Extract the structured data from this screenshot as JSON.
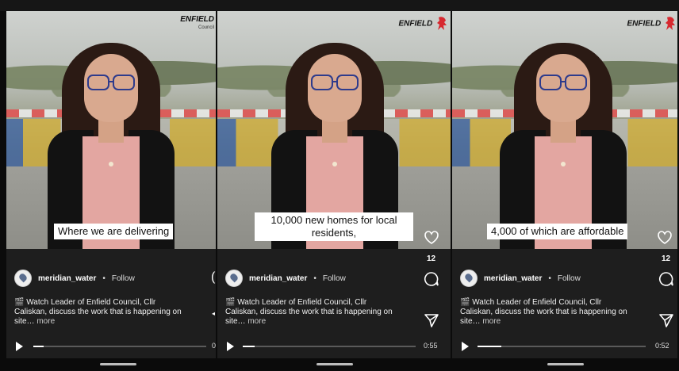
{
  "brand": {
    "name": "ENFIELD",
    "sub": "Council",
    "lion_color": "#d7282f"
  },
  "reel": {
    "username": "meridian_water",
    "separator": "•",
    "follow_label": "Follow",
    "description_line1": "🎬 Watch Leader of Enfield Council, Cllr",
    "description_line2": "Caliskan, discuss the work that is happening on",
    "description_line3_prefix": "site…",
    "more_label": "more"
  },
  "panels": [
    {
      "caption": "Where we are delivering",
      "likes": "",
      "time": "0",
      "progress": 0.06,
      "edge_glyph": "(",
      "edge_triangle": "◂"
    },
    {
      "caption_line1": "10,000 new homes for local",
      "caption_line2": "residents,",
      "likes": "12",
      "time": "0:55",
      "progress": 0.07
    },
    {
      "caption": "4,000 of which are affordable",
      "likes": "12",
      "time": "0:52",
      "progress": 0.14
    }
  ],
  "icons": {
    "heart": "heart-icon",
    "comment": "comment-icon",
    "share": "send-icon",
    "play": "play-icon"
  }
}
